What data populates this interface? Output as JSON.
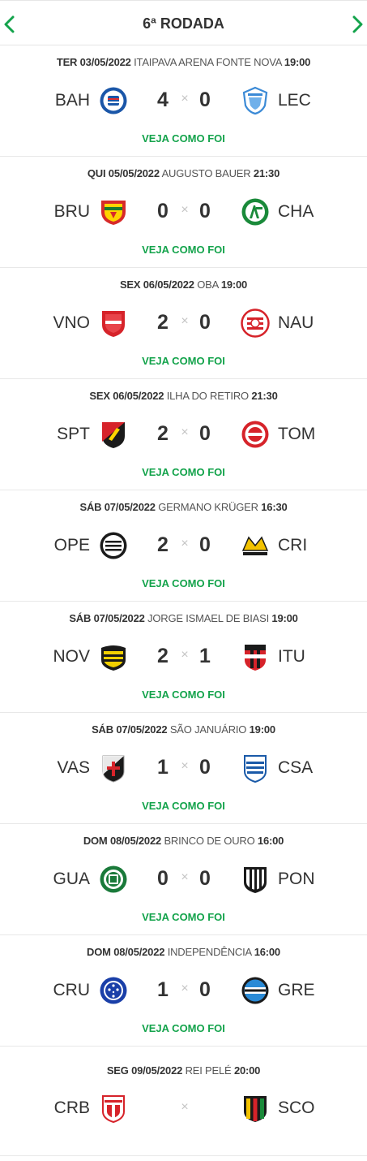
{
  "header": {
    "title": "6ª RODADA",
    "prev_icon": "chevron-left-icon",
    "next_icon": "chevron-right-icon",
    "accent_color": "#13a34b"
  },
  "matches": [
    {
      "date": "TER 03/05/2022",
      "venue": "ITAIPAVA ARENA FONTE NOVA",
      "time": "19:00",
      "home": "BAH",
      "away": "LEC",
      "home_score": "4",
      "away_score": "0",
      "times": "×",
      "link": "VEJA COMO FOI",
      "home_crest": "bahia-crest-icon",
      "away_crest": "londrina-crest-icon"
    },
    {
      "date": "QUI 05/05/2022",
      "venue": "AUGUSTO BAUER",
      "time": "21:30",
      "home": "BRU",
      "away": "CHA",
      "home_score": "0",
      "away_score": "0",
      "times": "×",
      "link": "VEJA COMO FOI",
      "home_crest": "brusque-crest-icon",
      "away_crest": "chapecoense-crest-icon"
    },
    {
      "date": "SEX 06/05/2022",
      "venue": "OBA",
      "time": "19:00",
      "home": "VNO",
      "away": "NAU",
      "home_score": "2",
      "away_score": "0",
      "times": "×",
      "link": "VEJA COMO FOI",
      "home_crest": "vila-nova-crest-icon",
      "away_crest": "nautico-crest-icon"
    },
    {
      "date": "SEX 06/05/2022",
      "venue": "ILHA DO RETIRO",
      "time": "21:30",
      "home": "SPT",
      "away": "TOM",
      "home_score": "2",
      "away_score": "0",
      "times": "×",
      "link": "VEJA COMO FOI",
      "home_crest": "sport-crest-icon",
      "away_crest": "tombense-crest-icon"
    },
    {
      "date": "SÁB 07/05/2022",
      "venue": "GERMANO KRÜGER",
      "time": "16:30",
      "home": "OPE",
      "away": "CRI",
      "home_score": "2",
      "away_score": "0",
      "times": "×",
      "link": "VEJA COMO FOI",
      "home_crest": "operario-crest-icon",
      "away_crest": "criciuma-crest-icon"
    },
    {
      "date": "SÁB 07/05/2022",
      "venue": "JORGE ISMAEL DE BIASI",
      "time": "19:00",
      "home": "NOV",
      "away": "ITU",
      "home_score": "2",
      "away_score": "1",
      "times": "×",
      "link": "VEJA COMO FOI",
      "home_crest": "novorizontino-crest-icon",
      "away_crest": "ituano-crest-icon"
    },
    {
      "date": "SÁB 07/05/2022",
      "venue": "SÃO JANUÁRIO",
      "time": "19:00",
      "home": "VAS",
      "away": "CSA",
      "home_score": "1",
      "away_score": "0",
      "times": "×",
      "link": "VEJA COMO FOI",
      "home_crest": "vasco-crest-icon",
      "away_crest": "csa-crest-icon"
    },
    {
      "date": "DOM 08/05/2022",
      "venue": "BRINCO DE OURO",
      "time": "16:00",
      "home": "GUA",
      "away": "PON",
      "home_score": "0",
      "away_score": "0",
      "times": "×",
      "link": "VEJA COMO FOI",
      "home_crest": "guarani-crest-icon",
      "away_crest": "ponte-preta-crest-icon"
    },
    {
      "date": "DOM 08/05/2022",
      "venue": "INDEPENDÊNCIA",
      "time": "16:00",
      "home": "CRU",
      "away": "GRE",
      "home_score": "1",
      "away_score": "0",
      "times": "×",
      "link": "VEJA COMO FOI",
      "home_crest": "cruzeiro-crest-icon",
      "away_crest": "gremio-crest-icon"
    },
    {
      "date": "SEG 09/05/2022",
      "venue": "REI PELÉ",
      "time": "20:00",
      "home": "CRB",
      "away": "SCO",
      "home_score": "",
      "away_score": "",
      "times": "×",
      "link": "",
      "home_crest": "crb-crest-icon",
      "away_crest": "sampaio-correa-crest-icon"
    }
  ]
}
